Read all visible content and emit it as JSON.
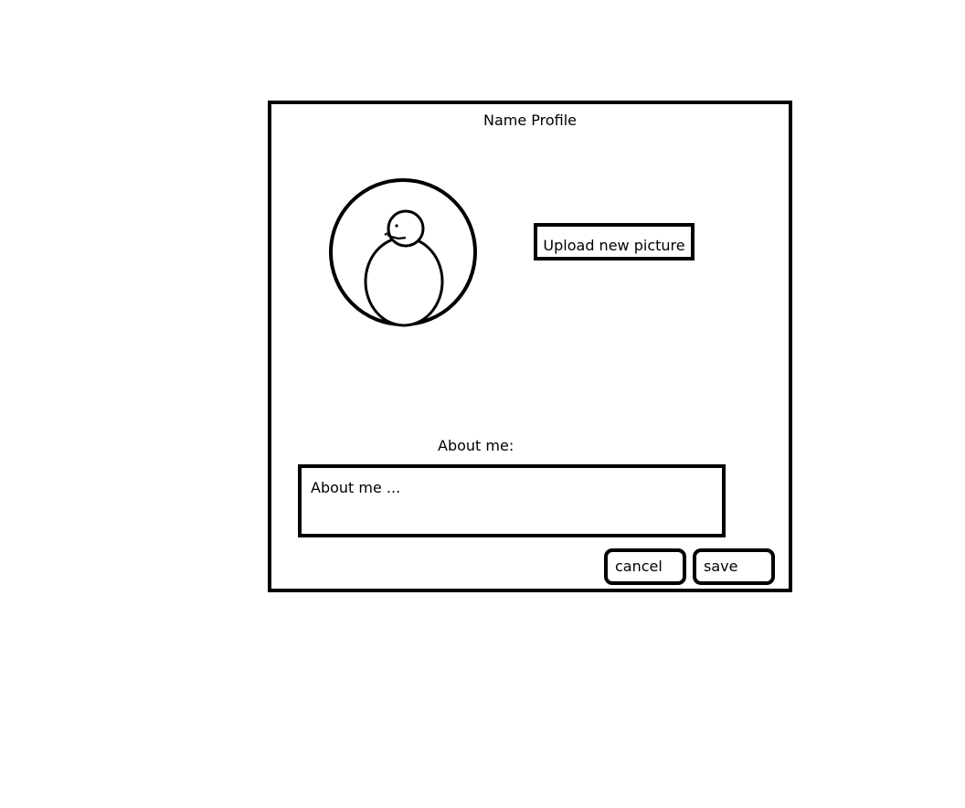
{
  "window": {
    "title": "Name Profile"
  },
  "avatar": {
    "icon": "user-avatar-icon"
  },
  "upload": {
    "label": "Upload new picture"
  },
  "about": {
    "label": "About me:",
    "placeholder": "About me ..."
  },
  "actions": {
    "cancel_label": "cancel",
    "save_label": "save"
  },
  "colors": {
    "stroke": "#000000",
    "background": "#ffffff"
  }
}
